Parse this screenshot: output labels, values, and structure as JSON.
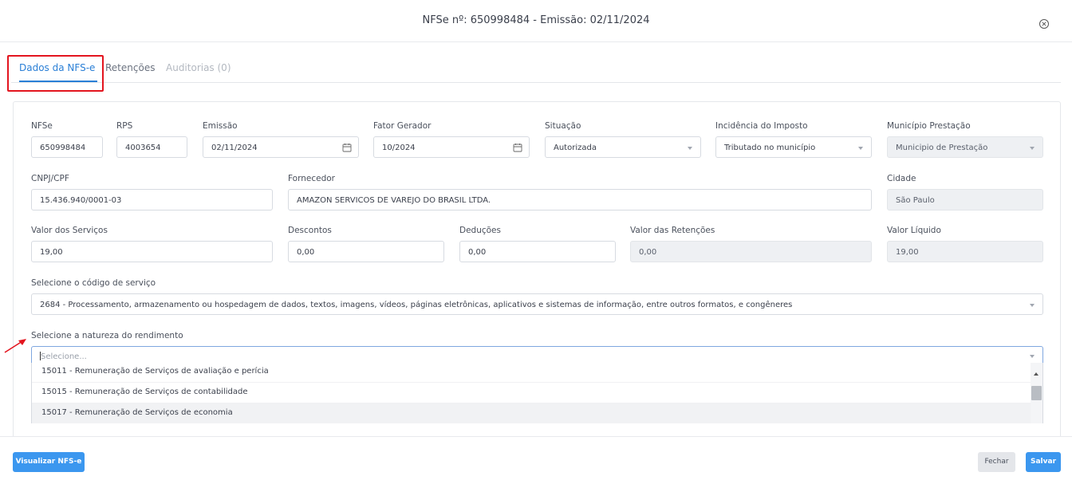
{
  "header": {
    "title": "NFSe nº: 650998484 - Emissão: 02/11/2024"
  },
  "tabs": [
    "Dados da NFS-e",
    "Retenções",
    "Auditorias (0)"
  ],
  "fields": {
    "nfse": {
      "label": "NFSe",
      "value": "650998484"
    },
    "rps": {
      "label": "RPS",
      "value": "4003654"
    },
    "emissao": {
      "label": "Emissão",
      "value": "02/11/2024"
    },
    "fator_gerador": {
      "label": "Fator Gerador",
      "value": "10/2024"
    },
    "situacao": {
      "label": "Situação",
      "value": "Autorizada"
    },
    "incidencia": {
      "label": "Incidência do Imposto",
      "value": "Tributado no município"
    },
    "municipio_prestacao": {
      "label": "Município Prestação",
      "value": "Municipio de Prestação"
    },
    "cnpj": {
      "label": "CNPJ/CPF",
      "value": "15.436.940/0001-03"
    },
    "fornecedor": {
      "label": "Fornecedor",
      "value": "AMAZON SERVICOS DE VAREJO DO BRASIL LTDA."
    },
    "cidade": {
      "label": "Cidade",
      "value": "São Paulo"
    },
    "valor_servicos": {
      "label": "Valor dos Serviços",
      "value": "19,00"
    },
    "descontos": {
      "label": "Descontos",
      "value": "0,00"
    },
    "deducoes": {
      "label": "Deduções",
      "value": "0,00"
    },
    "valor_retencoes": {
      "label": "Valor das Retenções",
      "value": "0,00"
    },
    "valor_liquido": {
      "label": "Valor Líquido",
      "value": "19,00"
    },
    "codigo_servico": {
      "label": "Selecione o código de serviço",
      "value": "2684 - Processamento, armazenamento ou hospedagem de dados, textos, imagens, vídeos, páginas eletrônicas, aplicativos e sistemas de informação, entre outros formatos, e congêneres"
    },
    "natureza_rendimento": {
      "label": "Selecione a natureza do rendimento",
      "placeholder": "Selecione..."
    }
  },
  "natureza_options": [
    "15011 - Remuneração de Serviços de avaliação e perícia",
    "15015 - Remuneração de Serviços de contabilidade",
    "15017 - Remuneração de Serviços de economia"
  ],
  "footer": {
    "visualizar_label": "Visualizar NFS-e",
    "fechar_label": "Fechar",
    "salvar_label": "Salvar"
  },
  "colors": {
    "accent": "#2a7fd6",
    "primary_button": "#3b97ef",
    "highlight": "#e3151f"
  }
}
